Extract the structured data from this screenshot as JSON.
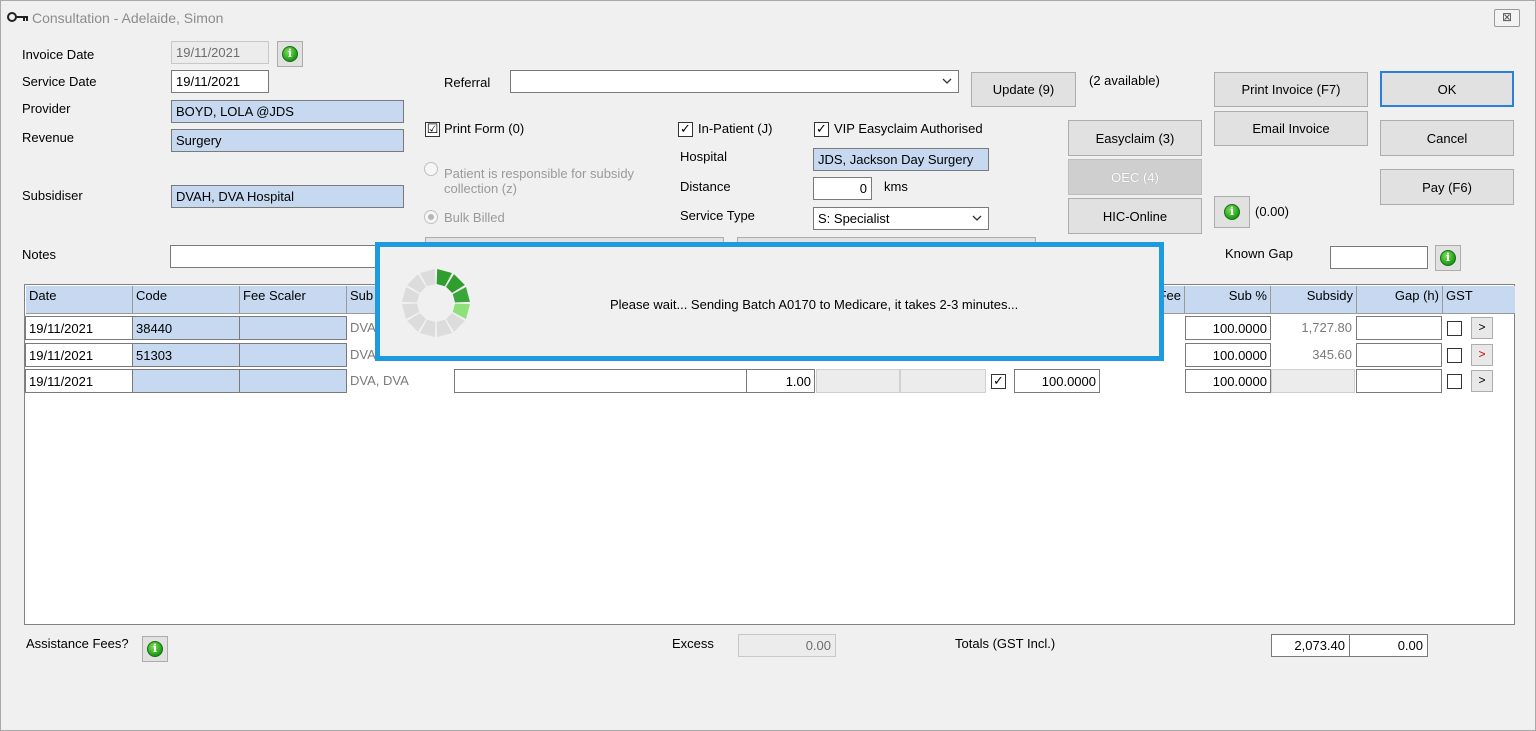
{
  "window": {
    "title": "Consultation - Adelaide, Simon",
    "close_glyph": "⊠"
  },
  "form": {
    "invoice_date_label": "Invoice Date",
    "invoice_date_value": "19/11/2021",
    "service_date_label": "Service Date",
    "service_date_value": "19/11/2021",
    "provider_label": "Provider",
    "provider_value": "BOYD, LOLA @JDS",
    "revenue_label": "Revenue",
    "revenue_value": "Surgery",
    "subsidiser_label": "Subsidiser",
    "subsidiser_value": "DVAH, DVA Hospital",
    "notes_label": "Notes",
    "notes_value": "",
    "referral_label": "Referral",
    "referral_value": "",
    "print_form_label": "Print Form (0)",
    "print_form_checked": "☑",
    "patient_responsible_label": "Patient is responsible for subsidy",
    "patient_responsible_label2": "collection (z)",
    "bulk_billed_label": "Bulk Billed",
    "in_patient_label": "In-Patient (J)",
    "in_patient_checked": "✓",
    "hospital_label": "Hospital",
    "hospital_value": "JDS, Jackson Day Surgery",
    "distance_label": "Distance",
    "distance_value": "0",
    "distance_unit": "kms",
    "service_type_label": "Service Type",
    "service_type_value": "S: Specialist",
    "vip_label": "VIP Easyclaim Authorised",
    "vip_checked": "✓",
    "known_gap_label": "Known Gap",
    "known_gap_value": ""
  },
  "buttons": {
    "update": "Update (9)",
    "available": "(2 available)",
    "easyclaim": "Easyclaim (3)",
    "oec": "OEC (4)",
    "hic_online": "HIC-Online",
    "print_invoice": "Print Invoice (F7)",
    "email_invoice": "Email Invoice",
    "ok": "OK",
    "cancel": "Cancel",
    "pay": "Pay (F6)",
    "pay_amount": "(0.00)",
    "info_glyph": "i"
  },
  "grid": {
    "headers": {
      "date": "Date",
      "code": "Code",
      "fee_scaler": "Fee Scaler",
      "subsidiser": "Sub",
      "fee": "Fee",
      "sub_pct": "Sub %",
      "subsidy": "Subsidy",
      "gap": "Gap (h)",
      "gst": "GST"
    },
    "rows": [
      {
        "date": "19/11/2021",
        "code": "38440",
        "fee_scaler": "",
        "subsidiser": "DVA",
        "sub_pct": "100.0000",
        "subsidy": "1,727.80",
        "gap": "",
        "arrow": ">"
      },
      {
        "date": "19/11/2021",
        "code": "51303",
        "fee_scaler": "",
        "subsidiser": "DVA",
        "sub_pct": "100.0000",
        "subsidy": "345.60",
        "gap": "",
        "arrow": ">"
      },
      {
        "date": "19/11/2021",
        "code": "",
        "fee_scaler": "",
        "subsidiser": "DVA, DVA",
        "description": "",
        "qty": "1.00",
        "check": "✓",
        "percent": "100.0000",
        "sub_pct": "100.0000",
        "subsidy": "",
        "gap": "",
        "arrow": ">"
      }
    ]
  },
  "footer": {
    "assistance_fees_label": "Assistance Fees?",
    "excess_label": "Excess",
    "excess_value": "0.00",
    "totals_label": "Totals (GST Incl.)",
    "total_value": "2,073.40",
    "gst_total_value": "0.00"
  },
  "overlay": {
    "message": "Please wait... Sending Batch A0170 to Medicare, it takes 2-3 minutes..."
  },
  "colors": {
    "accent": "#1e9ae0",
    "field_blue": "#c6d9f1",
    "info_green": "#1c9a16"
  }
}
